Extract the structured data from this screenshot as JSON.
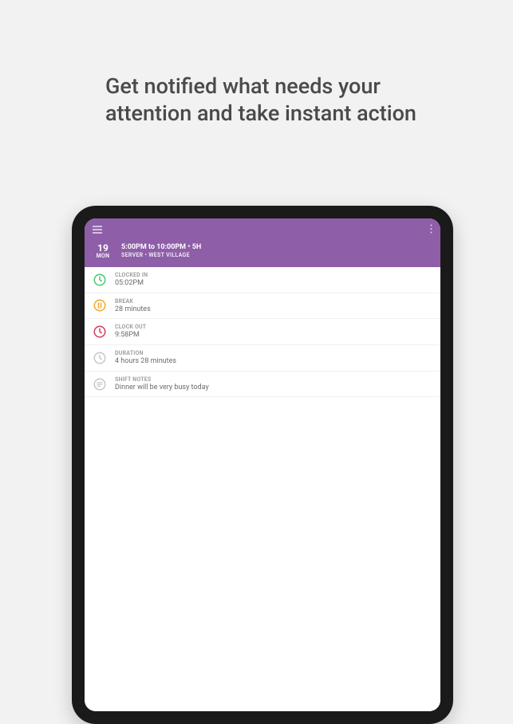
{
  "headline": "Get notified what needs your attention and take instant action",
  "header": {},
  "shift": {
    "date_num": "19",
    "date_day": "MON",
    "time_range": "5:00PM to 10:00PM • 5H",
    "role_location": "SERVER • WEST VILLAGE"
  },
  "rows": {
    "clocked_in": {
      "label": "CLOCKED IN",
      "value": "05:02PM",
      "icon_color": "#4ac76d"
    },
    "break": {
      "label": "BREAK",
      "value": "28 minutes",
      "icon_color": "#f0a72e"
    },
    "clock_out": {
      "label": "CLOCK OUT",
      "value": "9:58PM",
      "icon_color": "#d63a5a"
    },
    "duration": {
      "label": "DURATION",
      "value": "4 hours 28 minutes",
      "icon_color": "#c7c7c7"
    },
    "shift_notes": {
      "label": "SHIFT NOTES",
      "value": "Dinner will be very busy today",
      "icon_color": "#c7c7c7"
    }
  }
}
